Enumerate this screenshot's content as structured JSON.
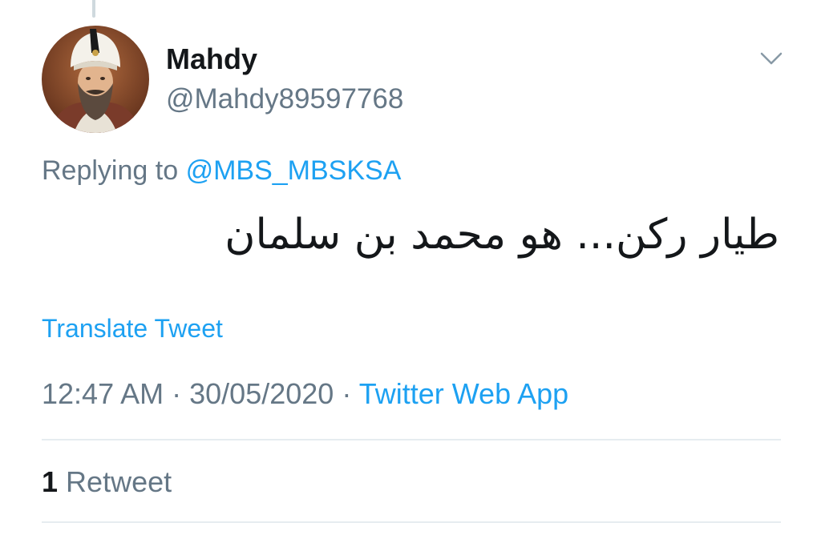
{
  "tweet": {
    "display_name": "Mahdy",
    "handle": "@Mahdy89597768",
    "reply_prefix": "Replying to",
    "reply_to": "@MBS_MBSKSA",
    "text": "طيار ركن... هو محمد بن سلمان",
    "translate_label": "Translate Tweet",
    "time": "12:47 AM",
    "separator": "·",
    "date": "30/05/2020",
    "source": "Twitter Web App",
    "retweet_count": "1",
    "retweet_label": "Retweet"
  },
  "icons": {
    "more": "chevron-down-icon",
    "avatar": "profile-portrait"
  },
  "colors": {
    "link": "#1da1f2",
    "secondary_text": "#657786",
    "primary_text": "#14171a",
    "divider": "#e6ecf0"
  }
}
